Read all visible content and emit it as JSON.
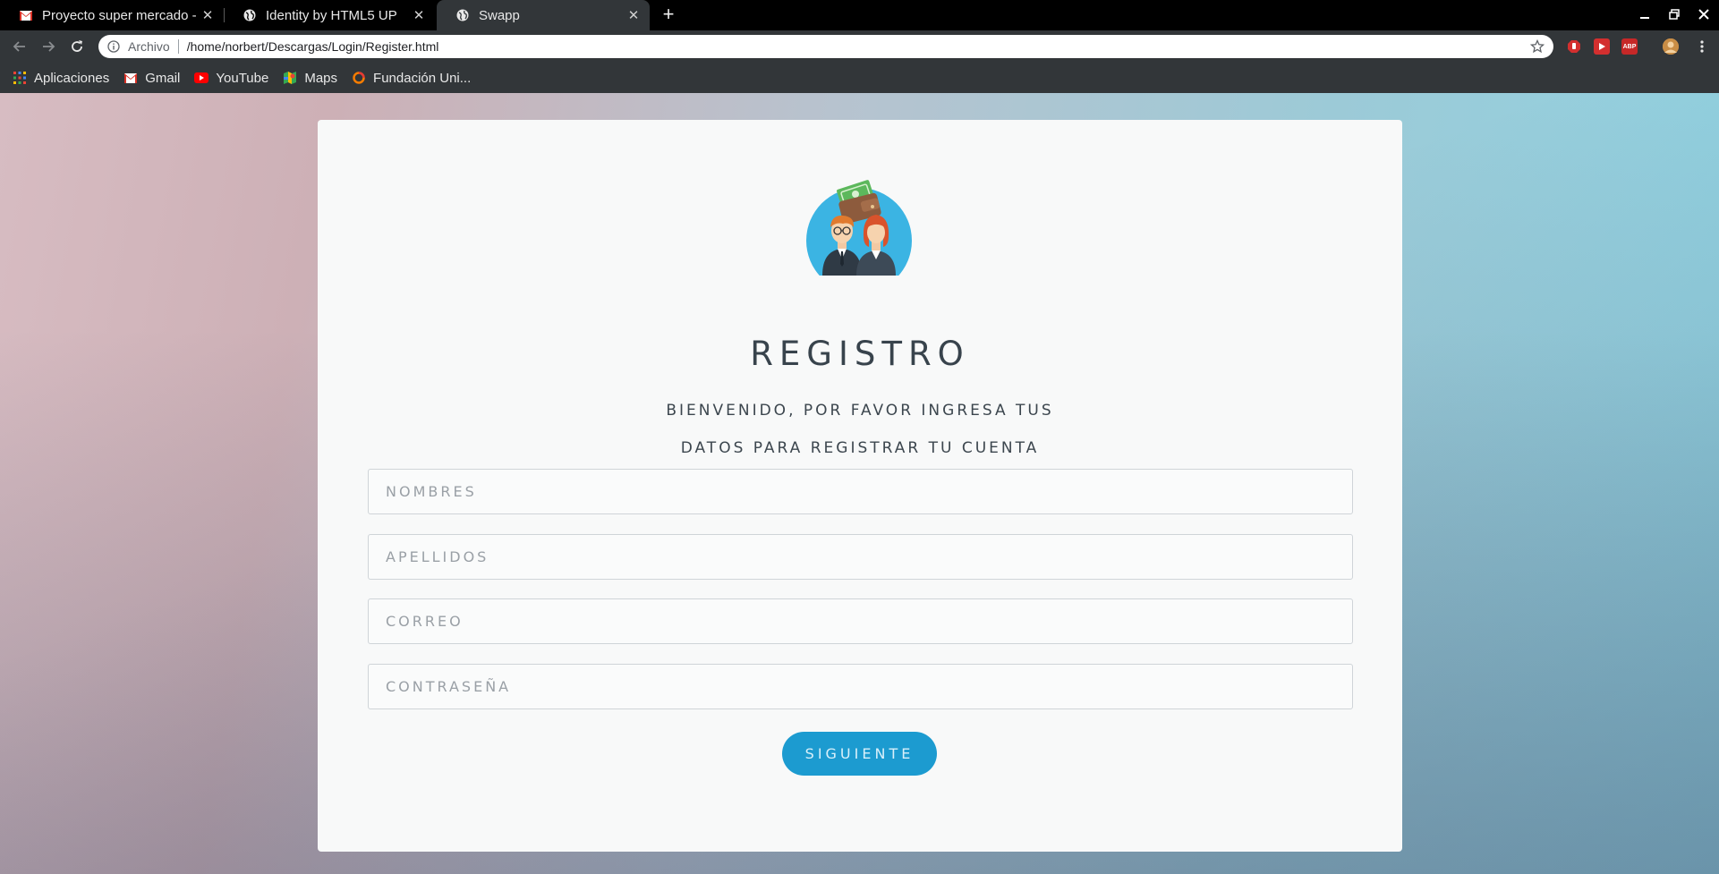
{
  "browser": {
    "tabs": [
      {
        "title": "Proyecto super mercado -",
        "favicon": "gmail-icon",
        "active": false
      },
      {
        "title": "Identity by HTML5 UP",
        "favicon": "globe-icon",
        "active": false
      },
      {
        "title": "Swapp",
        "favicon": "globe-icon",
        "active": true
      }
    ],
    "omnibox": {
      "chip": "Archivo",
      "url": "/home/norbert/Descargas/Login/Register.html"
    },
    "bookmarks": [
      {
        "label": "Aplicaciones",
        "icon": "apps-grid-icon"
      },
      {
        "label": "Gmail",
        "icon": "gmail-icon"
      },
      {
        "label": "YouTube",
        "icon": "youtube-icon"
      },
      {
        "label": "Maps",
        "icon": "maps-icon"
      },
      {
        "label": "Fundación Uni...",
        "icon": "fundacion-icon"
      }
    ],
    "extensions": [
      "stop-extension-icon",
      "video-extension-icon",
      "adblock-extension-icon",
      "profile-avatar-icon",
      "menu-dots-icon"
    ]
  },
  "register": {
    "avatar_icon": "users-wallet-icon",
    "title": "REGISTRO",
    "subtitle_line1": "BIENVENIDO, POR FAVOR INGRESA TUS",
    "subtitle_line2": "DATOS PARA REGISTRAR TU CUENTA",
    "fields": [
      {
        "placeholder": "NOMBRES",
        "value": ""
      },
      {
        "placeholder": "APELLIDOS",
        "value": ""
      },
      {
        "placeholder": "CORREO",
        "value": ""
      },
      {
        "placeholder": "CONTRASEÑA",
        "value": ""
      }
    ],
    "submit_label": "SIGUIENTE"
  },
  "colors": {
    "accent": "#1c9bd0",
    "card": "#f8f9f9",
    "text": "#38434c"
  }
}
